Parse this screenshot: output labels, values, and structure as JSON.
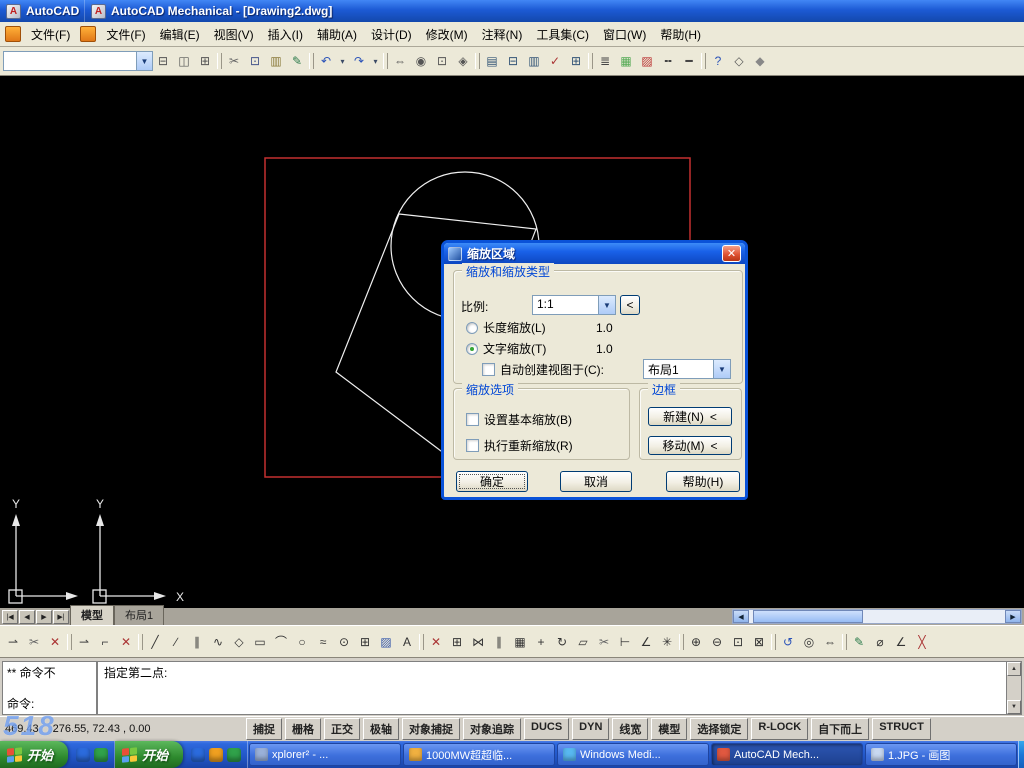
{
  "window": {
    "title_small": "AutoCAD",
    "title": "AutoCAD Mechanical - [Drawing2.dwg]"
  },
  "menubar": {
    "small": [
      "文件(F)"
    ],
    "items": [
      "文件(F)",
      "编辑(E)",
      "视图(V)",
      "插入(I)",
      "辅助(A)",
      "设计(D)",
      "修改(M)",
      "注释(N)",
      "工具集(C)",
      "窗口(W)",
      "帮助(H)"
    ]
  },
  "toolbar_top": [
    {
      "n": "toolbar-grip",
      "cls": "grip"
    },
    {
      "n": "new-icon",
      "g": "▯",
      "c": "#44548A"
    },
    {
      "n": "open-icon",
      "g": "▤",
      "c": "#C08A28"
    },
    {
      "n": "save-icon",
      "g": "▣",
      "c": "#2A52B8"
    },
    {
      "n": "toolbar-grip",
      "cls": "grip"
    },
    {
      "n": "new-icon",
      "g": "▯",
      "c": "#44548A"
    },
    {
      "n": "open-icon",
      "g": "▤",
      "c": "#C08A28"
    },
    {
      "n": "save-icon",
      "g": "▣",
      "c": "#2A52B8"
    },
    {
      "n": "toolbar-grip",
      "cls": "grip"
    },
    {
      "n": "plot-icon",
      "g": "⊟",
      "c": "#555555"
    },
    {
      "n": "plot-preview-icon",
      "g": "◫",
      "c": "#555555"
    },
    {
      "n": "publish-icon",
      "g": "⊞",
      "c": "#555555"
    },
    {
      "n": "toolbar-grip",
      "cls": "grip"
    },
    {
      "n": "cut-icon",
      "g": "✂",
      "c": "#666666"
    },
    {
      "n": "copy-icon",
      "g": "⊡",
      "c": "#44548A"
    },
    {
      "n": "paste-icon",
      "g": "▥",
      "c": "#8A7A3A"
    },
    {
      "n": "match-properties-icon",
      "g": "✎",
      "c": "#2A7A4A"
    },
    {
      "n": "toolbar-grip",
      "cls": "grip"
    },
    {
      "n": "workspace-combo",
      "cls": "combo",
      "g": "▼"
    },
    {
      "n": "undo-icon",
      "g": "↶",
      "c": "#2A52B8"
    },
    {
      "n": "undo-drop-icon",
      "g": "▾",
      "cls": "drop"
    },
    {
      "n": "redo-icon",
      "g": "↷",
      "c": "#2A52B8"
    },
    {
      "n": "redo-drop-icon",
      "g": "▾",
      "cls": "drop"
    },
    {
      "n": "toolbar-grip",
      "cls": "grip"
    },
    {
      "n": "pan-icon",
      "g": "⇔",
      "c": "#555555"
    },
    {
      "n": "zoom-realtime-icon",
      "g": "◉",
      "c": "#555555"
    },
    {
      "n": "zoom-window-icon",
      "g": "⊡",
      "c": "#555555"
    },
    {
      "n": "zoom-previous-icon",
      "g": "◈",
      "c": "#555555"
    },
    {
      "n": "toolbar-grip",
      "cls": "grip"
    },
    {
      "n": "properties-icon",
      "g": "▤",
      "c": "#335577"
    },
    {
      "n": "dbconnect-icon",
      "g": "⊟",
      "c": "#335577"
    },
    {
      "n": "sheetset-icon",
      "g": "▥",
      "c": "#335577"
    },
    {
      "n": "markup-icon",
      "g": "✓",
      "c": "#AA3333"
    },
    {
      "n": "quickcalc-icon",
      "g": "⊞",
      "c": "#335577"
    },
    {
      "n": "toolbar-grip",
      "cls": "grip"
    },
    {
      "n": "layers-icon",
      "g": "≣",
      "c": "#444444"
    },
    {
      "n": "layer-states-icon",
      "g": "▦",
      "c": "#55AA55"
    },
    {
      "n": "color-icon",
      "g": "▨",
      "c": "#BB3333"
    },
    {
      "n": "linetype-icon",
      "g": "╍",
      "c": "#444444"
    },
    {
      "n": "lineweight-icon",
      "g": "━",
      "c": "#444444"
    },
    {
      "n": "toolbar-grip",
      "cls": "grip"
    },
    {
      "n": "help-icon",
      "g": "?",
      "c": "#2A52B8"
    },
    {
      "n": "styles-icon",
      "g": "◇",
      "c": "#555555"
    },
    {
      "n": "standards-icon",
      "g": "◆",
      "c": "#888888"
    }
  ],
  "toolbar_bottom": [
    {
      "n": "snap-from-icon",
      "g": "⇀",
      "c": "#444444"
    },
    {
      "n": "trim-mini-icon",
      "g": "✂",
      "c": "#666666"
    },
    {
      "n": "erase-mini-icon",
      "g": "✕",
      "c": "#AA3333"
    },
    {
      "n": "toolbar-grip",
      "cls": "grip"
    },
    {
      "n": "snap-from-icon",
      "g": "⇀",
      "c": "#444444"
    },
    {
      "n": "corner-icon",
      "g": "⌐",
      "c": "#444444"
    },
    {
      "n": "erase-mini-icon",
      "g": "✕",
      "c": "#AA3333"
    },
    {
      "n": "toolbar-grip",
      "cls": "grip"
    },
    {
      "n": "line-icon",
      "g": "╱",
      "c": "#333333"
    },
    {
      "n": "construction-line-icon",
      "g": "∕",
      "c": "#333333"
    },
    {
      "n": "multiline-icon",
      "g": "∥",
      "c": "#333333"
    },
    {
      "n": "polyline-icon",
      "g": "∿",
      "c": "#333333"
    },
    {
      "n": "polygon-icon",
      "g": "◇",
      "c": "#333333"
    },
    {
      "n": "rectangle-icon",
      "g": "▭",
      "c": "#333333"
    },
    {
      "n": "arc-icon",
      "g": "⌒",
      "c": "#333333"
    },
    {
      "n": "circle-icon",
      "g": "○",
      "c": "#333333"
    },
    {
      "n": "spline-icon",
      "g": "≈",
      "c": "#333333"
    },
    {
      "n": "ellipse-icon",
      "g": "⊙",
      "c": "#333333"
    },
    {
      "n": "insert-block-icon",
      "g": "⊞",
      "c": "#333333"
    },
    {
      "n": "hatch-icon",
      "g": "▨",
      "c": "#3355AA"
    },
    {
      "n": "text-icon",
      "g": "A",
      "c": "#333333"
    },
    {
      "n": "toolbar-grip",
      "cls": "grip"
    },
    {
      "n": "erase-icon",
      "g": "✕",
      "c": "#AA3333"
    },
    {
      "n": "copy-object-icon",
      "g": "⊞",
      "c": "#333333"
    },
    {
      "n": "mirror-icon",
      "g": "⋈",
      "c": "#333333"
    },
    {
      "n": "offset-icon",
      "g": "∥",
      "c": "#333333"
    },
    {
      "n": "array-icon",
      "g": "▦",
      "c": "#333333"
    },
    {
      "n": "move-icon",
      "g": "+",
      "c": "#333333"
    },
    {
      "n": "rotate-icon",
      "g": "↻",
      "c": "#333333"
    },
    {
      "n": "scale-icon",
      "g": "▱",
      "c": "#333333"
    },
    {
      "n": "trim-icon",
      "g": "✂",
      "c": "#666666"
    },
    {
      "n": "extend-icon",
      "g": "⊢",
      "c": "#333333"
    },
    {
      "n": "fillet-icon",
      "g": "∠",
      "c": "#333333"
    },
    {
      "n": "explode-icon",
      "g": "✳",
      "c": "#333333"
    },
    {
      "n": "toolbar-grip",
      "cls": "grip"
    },
    {
      "n": "zoom-in-icon",
      "g": "⊕",
      "c": "#333333"
    },
    {
      "n": "zoom-out-icon",
      "g": "⊖",
      "c": "#333333"
    },
    {
      "n": "zoom-window2-icon",
      "g": "⊡",
      "c": "#333333"
    },
    {
      "n": "zoom-extents-icon",
      "g": "⊠",
      "c": "#333333"
    },
    {
      "n": "toolbar-grip",
      "cls": "grip"
    },
    {
      "n": "undo-view-icon",
      "g": "↺",
      "c": "#2A52B8"
    },
    {
      "n": "orbit-icon",
      "g": "◎",
      "c": "#333333"
    },
    {
      "n": "pan2-icon",
      "g": "⇔",
      "c": "#333333"
    },
    {
      "n": "toolbar-grip",
      "cls": "grip"
    },
    {
      "n": "sketch-icon",
      "g": "✎",
      "c": "#2A7A4A"
    },
    {
      "n": "diameter-icon",
      "g": "⌀",
      "c": "#333333"
    },
    {
      "n": "angle-icon",
      "g": "∠",
      "c": "#333333"
    },
    {
      "n": "cross-icon",
      "g": "╳",
      "c": "#AA3333"
    }
  ],
  "drawing": {
    "ucs_y": "Y",
    "ucs_x": "X"
  },
  "dialog": {
    "title": "缩放区域",
    "group_type": "缩放和缩放类型",
    "scale_label": "比例:",
    "scale_value": "1:1",
    "pick_button": "<",
    "radio_length": "长度缩放(L)",
    "radio_length_value": "1.0",
    "radio_text": "文字缩放(T)",
    "radio_text_value": "1.0",
    "check_autoview": "自动创建视图于(C):",
    "layout_value": "布局1",
    "group_options": "缩放选项",
    "check_base": "设置基本缩放(B)",
    "check_rescale": "执行重新缩放(R)",
    "group_border": "边框",
    "btn_new": "新建(N)",
    "btn_new_pick": "<",
    "btn_move": "移动(M)",
    "btn_move_pick": "<",
    "ok": "确定",
    "cancel": "取消",
    "help": "帮助(H)",
    "close_glyph": "✕"
  },
  "tabs_nav": [
    "|◀",
    "◀",
    "▶",
    "▶|"
  ],
  "tabs": [
    {
      "label": "模型",
      "cls": "active"
    },
    {
      "label": "布局1"
    }
  ],
  "scroll": {
    "left": "◀",
    "right": "▶",
    "up": "▲",
    "down": "▼"
  },
  "command": {
    "left_top": "** 命令不",
    "left_bottom": "命令:",
    "prompt": "指定第二点:"
  },
  "status": {
    "coords_left": "469.43",
    "coords": "276.55, 72.43 , 0.00",
    "buttons": [
      "捕捉",
      "栅格",
      "正交",
      "极轴",
      "对象捕捉",
      "对象追踪",
      "DUCS",
      "DYN",
      "线宽",
      "模型",
      "选择锁定",
      "R-LOCK",
      "自下而上",
      "STRUCT"
    ]
  },
  "watermark": "518",
  "taskbar": {
    "start": "开始",
    "quick1": [
      {
        "n": "quick-launch-ie-icon",
        "c": "#2B6BDD"
      },
      {
        "n": "quick-launch-media-icon",
        "c": "#30A24A"
      }
    ],
    "quick2": [
      {
        "n": "quick-launch-ie-icon",
        "c": "#2B6BDD"
      },
      {
        "n": "quick-launch-folder-icon",
        "c": "#F0A020"
      },
      {
        "n": "quick-launch-media-icon",
        "c": "#30A24A"
      }
    ],
    "items": [
      {
        "label": "xplorer² - ...",
        "c": "#9AB0D8"
      },
      {
        "label": "1000MW超超临...",
        "c": "#F0B040"
      },
      {
        "label": "Windows Medi...",
        "c": "#58B8F0"
      },
      {
        "label": "AutoCAD Mech...",
        "c": "#E05840",
        "cls": "pressed"
      },
      {
        "label": "1.JPG - 画图",
        "c": "#C8D8F0"
      }
    ],
    "tray": [
      {
        "n": "tray-green-orb-icon",
        "c": "#30C050"
      },
      {
        "n": "tray-network-icon",
        "c": "#3090F0"
      },
      {
        "n": "tray-messenger-icon",
        "c": "#80D0FF"
      },
      {
        "n": "tray-update-icon",
        "c": "#F07030"
      },
      {
        "n": "tray-volume-icon",
        "c": "#3060D0"
      }
    ]
  },
  "colors": {
    "accent": "#0054E3",
    "entity_rect": "#C43030",
    "entity_line": "#F0F0F0"
  }
}
